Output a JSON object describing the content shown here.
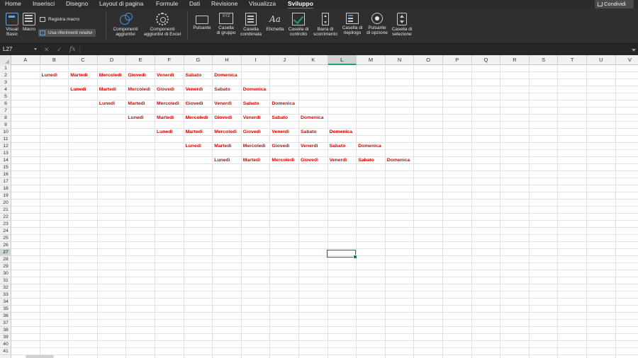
{
  "menu": {
    "tabs": [
      "Home",
      "Inserisci",
      "Disegno",
      "Layout di pagina",
      "Formule",
      "Dati",
      "Revisione",
      "Visualizza",
      "Sviluppo"
    ],
    "active_tab": "Sviluppo",
    "share_label": "Condividi"
  },
  "ribbon": {
    "visual_basic": "Visual\nBasic",
    "macro": "Macro",
    "record_macro": "Registra macro",
    "relative_refs": "Usa riferimenti relativi",
    "addins": "Componenti\naggiuntivi",
    "excel_addins": "Componenti\naggiuntivi di Excel",
    "button": "Pulsante",
    "group_box": "Casella\ndi gruppo",
    "group_box_icon_text": "XYZ",
    "combo_box": "Casella\ncombinata",
    "label": "Etichetta",
    "label_icon_text": "Aa",
    "checkbox": "Casella di\ncontrollo",
    "scrollbar": "Barra di\nscorrimento",
    "list_box": "Casella di\nriepilogo",
    "option_button": "Pulsante\ndi opzione",
    "spin_box": "Casella di\nselezione"
  },
  "formula_bar": {
    "name_box": "L27",
    "cancel_symbol": "✕",
    "enter_symbol": "✓",
    "fx": "fx",
    "formula": ""
  },
  "sheet": {
    "columns": [
      "A",
      "B",
      "C",
      "D",
      "E",
      "F",
      "G",
      "H",
      "I",
      "J",
      "K",
      "L",
      "M",
      "N",
      "O",
      "P",
      "Q",
      "R",
      "S",
      "T",
      "U",
      "V"
    ],
    "row_count": 41,
    "selected_cell": "L27",
    "selected_col": "L",
    "selected_row": 27,
    "text_color": "#e00000",
    "cells": [
      {
        "ref": "B2",
        "value": "Lunedì"
      },
      {
        "ref": "C2",
        "value": "Martedì"
      },
      {
        "ref": "D2",
        "value": "Mercoledì"
      },
      {
        "ref": "E2",
        "value": "Giovedì"
      },
      {
        "ref": "F2",
        "value": "Venerdì"
      },
      {
        "ref": "G2",
        "value": "Sabato"
      },
      {
        "ref": "H2",
        "value": "Domenica"
      },
      {
        "ref": "C4",
        "value": "Lunedì"
      },
      {
        "ref": "D4",
        "value": "Martedì"
      },
      {
        "ref": "E4",
        "value": "Mercoledì"
      },
      {
        "ref": "F4",
        "value": "Giovedì"
      },
      {
        "ref": "G4",
        "value": "Venerdì"
      },
      {
        "ref": "H4",
        "value": "Sabato"
      },
      {
        "ref": "I4",
        "value": "Domenica"
      },
      {
        "ref": "D6",
        "value": "Lunedì"
      },
      {
        "ref": "E6",
        "value": "Martedì"
      },
      {
        "ref": "F6",
        "value": "Mercoledì"
      },
      {
        "ref": "G6",
        "value": "Giovedì"
      },
      {
        "ref": "H6",
        "value": "Venerdì"
      },
      {
        "ref": "I6",
        "value": "Sabato"
      },
      {
        "ref": "J6",
        "value": "Domenica"
      },
      {
        "ref": "E8",
        "value": "Lunedì"
      },
      {
        "ref": "F8",
        "value": "Martedì"
      },
      {
        "ref": "G8",
        "value": "Mercoledì"
      },
      {
        "ref": "H8",
        "value": "Giovedì"
      },
      {
        "ref": "I8",
        "value": "Venerdì"
      },
      {
        "ref": "J8",
        "value": "Sabato"
      },
      {
        "ref": "K8",
        "value": "Domenica"
      },
      {
        "ref": "F10",
        "value": "Lunedì"
      },
      {
        "ref": "G10",
        "value": "Martedì"
      },
      {
        "ref": "H10",
        "value": "Mercoledì"
      },
      {
        "ref": "I10",
        "value": "Giovedì"
      },
      {
        "ref": "J10",
        "value": "Venerdì"
      },
      {
        "ref": "K10",
        "value": "Sabato"
      },
      {
        "ref": "L10",
        "value": "Domenica"
      },
      {
        "ref": "G12",
        "value": "Lunedì"
      },
      {
        "ref": "H12",
        "value": "Martedì"
      },
      {
        "ref": "I12",
        "value": "Mercoledì"
      },
      {
        "ref": "J12",
        "value": "Giovedì"
      },
      {
        "ref": "K12",
        "value": "Venerdì"
      },
      {
        "ref": "L12",
        "value": "Sabato"
      },
      {
        "ref": "M12",
        "value": "Domenica"
      },
      {
        "ref": "H14",
        "value": "Lunedì"
      },
      {
        "ref": "I14",
        "value": "Martedì"
      },
      {
        "ref": "J14",
        "value": "Mercoledì"
      },
      {
        "ref": "K14",
        "value": "Giovedì"
      },
      {
        "ref": "L14",
        "value": "Venerdì"
      },
      {
        "ref": "M14",
        "value": "Sabato"
      },
      {
        "ref": "N14",
        "value": "Domenica"
      }
    ]
  }
}
